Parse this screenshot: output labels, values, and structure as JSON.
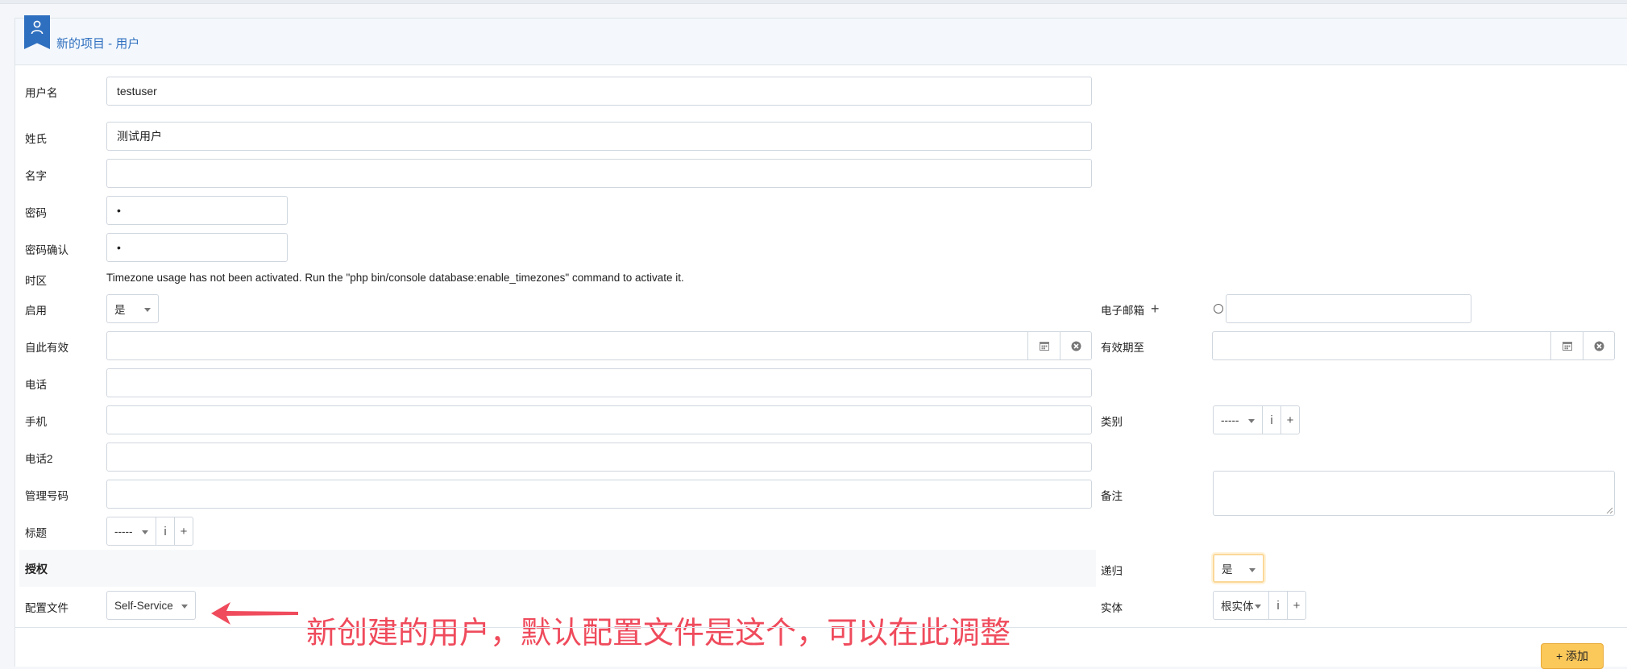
{
  "header": {
    "title": "新的项目 - 用户"
  },
  "form": {
    "username": {
      "label": "用户名",
      "value": "testuser"
    },
    "surname": {
      "label": "姓氏",
      "value": "测试用户"
    },
    "firstname": {
      "label": "名字",
      "value": ""
    },
    "password": {
      "label": "密码",
      "value": "•"
    },
    "password_confirm": {
      "label": "密码确认",
      "value": "•"
    },
    "timezone": {
      "label": "时区",
      "note": "Timezone usage has not been activated. Run the \"php bin/console database:enable_timezones\" command to activate it."
    },
    "enabled": {
      "label": "启用",
      "value": "是"
    },
    "valid_from": {
      "label": "自此有效",
      "value": ""
    },
    "phone": {
      "label": "电话",
      "value": ""
    },
    "mobile": {
      "label": "手机",
      "value": ""
    },
    "phone2": {
      "label": "电话2",
      "value": ""
    },
    "admin_number": {
      "label": "管理号码",
      "value": ""
    },
    "title": {
      "label": "标题",
      "value": "-----"
    },
    "authorization": {
      "label": "授权"
    },
    "profile": {
      "label": "配置文件",
      "value": "Self-Service"
    },
    "email": {
      "label": "电子邮箱",
      "value": ""
    },
    "valid_until": {
      "label": "有效期至",
      "value": ""
    },
    "category": {
      "label": "类别",
      "value": "-----"
    },
    "comment": {
      "label": "备注",
      "value": ""
    },
    "recursive": {
      "label": "递归",
      "value": "是"
    },
    "entity": {
      "label": "实体",
      "value": "根实体"
    }
  },
  "glyphs": {
    "info": "i",
    "plus": "+"
  },
  "actions": {
    "add_label": "+ 添加"
  },
  "annotation": {
    "text": "新创建的用户，默认配置文件是这个，可以在此调整"
  },
  "colors": {
    "accent": "#2f6fbf",
    "add_button": "#fbc85a",
    "annotation": "#ef4b5c"
  }
}
